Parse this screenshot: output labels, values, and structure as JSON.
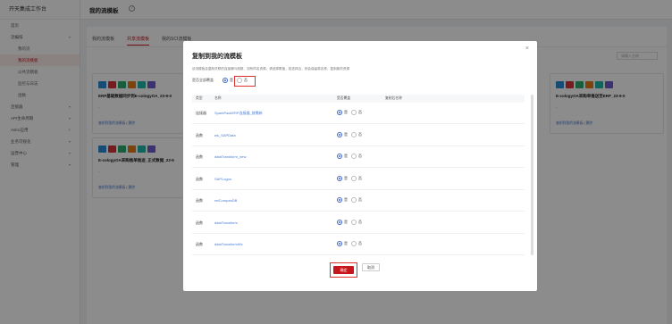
{
  "sidebar": {
    "brand": "开天集成工作台",
    "items": [
      {
        "label": "首页",
        "sub": false,
        "arrow": ""
      },
      {
        "label": "流编排",
        "sub": false,
        "arrow": "▾"
      },
      {
        "label": "我的流",
        "sub": true,
        "arrow": ""
      },
      {
        "label": "我的流模板",
        "sub": true,
        "arrow": "",
        "active": true
      },
      {
        "label": "公共流模板",
        "sub": true,
        "arrow": ""
      },
      {
        "label": "监控与日志",
        "sub": true,
        "arrow": ""
      },
      {
        "label": "函数",
        "sub": true,
        "arrow": ""
      },
      {
        "label": "连接器",
        "sub": false,
        "arrow": "▾"
      },
      {
        "label": "API生命周期",
        "sub": false,
        "arrow": "▾"
      },
      {
        "label": "Astro应用",
        "sub": false,
        "arrow": "↗"
      },
      {
        "label": "业务可视化",
        "sub": false,
        "arrow": "▾"
      },
      {
        "label": "运营中心",
        "sub": false,
        "arrow": "▾"
      },
      {
        "label": "管理",
        "sub": false,
        "arrow": "▾"
      }
    ]
  },
  "header": {
    "title": "我的流模板",
    "help_icon": "question-circle-icon"
  },
  "tabs": [
    "我的流模板",
    "共享流模板",
    "我的SCI流模板"
  ],
  "bg_search_placeholder": "请输入名称",
  "cards": [
    {
      "title": "ERP基础数据同步到E-cologyOA_23-9-0",
      "foot": "复制到我的流模板  |  删除"
    },
    {
      "title": "E-cologyOA采购推单推送_正式数据_23-9",
      "foot": "复制到我的流模板  |  删除"
    },
    {
      "title": "E-cologyOA采购单推送至ERP_23-9-0",
      "foot": "复制到我的流模板  |  删除"
    }
  ],
  "icon_colors": [
    "#2a8bd6",
    "#d8343a",
    "#2fae6f",
    "#e07a1a",
    "#1fb5a8",
    "#6d5bd0"
  ],
  "modal": {
    "title": "复制到我的流模板",
    "close_icon": "close-icon",
    "description": "该流模板会复制关联的连接器与函数，如有同名资源，请选择覆盖，若选择否，则会保留原名称，复制新的资源",
    "all_overwrite_label": "是否全部覆盖",
    "yes": "是",
    "no": "否",
    "columns": [
      "类型",
      "名称",
      "是否覆盖",
      "复制后名称"
    ],
    "rows": [
      {
        "type": "连接器",
        "name": "SparkPackERP连接器_按需新"
      },
      {
        "type": "函数",
        "name": "ws_SAPData"
      },
      {
        "type": "函数",
        "name": "dataTransform_new"
      },
      {
        "type": "函数",
        "name": "SAPLogon"
      },
      {
        "type": "函数",
        "name": "retCompanDB"
      },
      {
        "type": "函数",
        "name": "dataTransform"
      },
      {
        "type": "函数",
        "name": "dataTransformWx"
      }
    ],
    "ok_label": "确定",
    "cancel_label": "取消"
  }
}
